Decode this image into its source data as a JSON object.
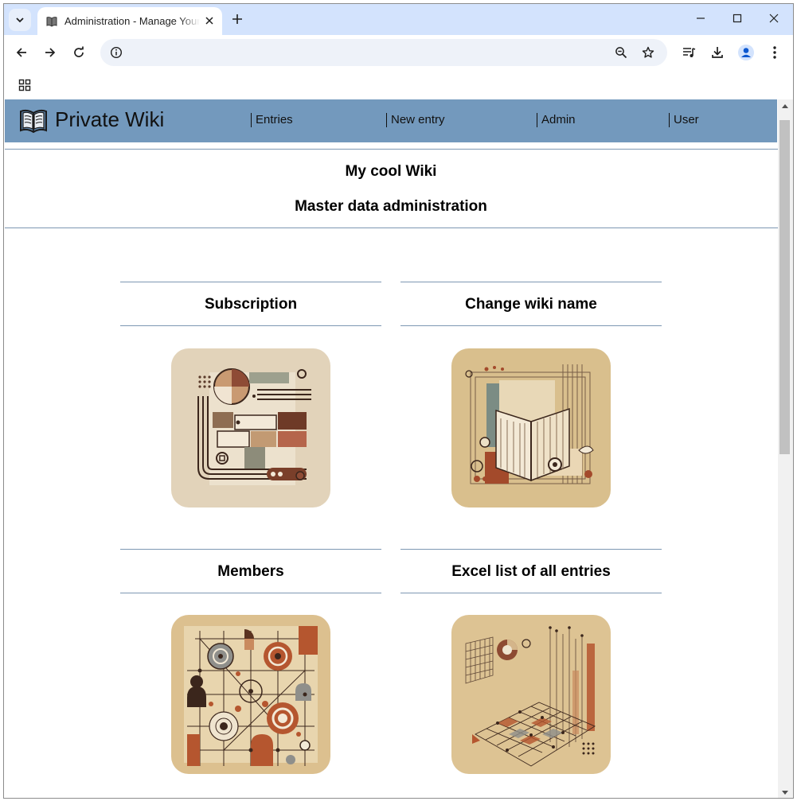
{
  "browser": {
    "tab_title": "Administration - Manage Your Private Wiki",
    "url": "",
    "colors": {
      "tabstrip": "#d3e3fd",
      "omnibox": "#eef2f9"
    }
  },
  "site": {
    "title": "Private Wiki",
    "nav": [
      {
        "label": "Entries"
      },
      {
        "label": "New entry"
      },
      {
        "label": "Admin"
      },
      {
        "label": "User"
      }
    ],
    "header_color": "#7399bd"
  },
  "page": {
    "wiki_name": "My cool Wiki",
    "section_title": "Master data administration"
  },
  "cards": [
    {
      "title": "Subscription"
    },
    {
      "title": "Change wiki name"
    },
    {
      "title": "Members"
    },
    {
      "title": "Excel list of all entries"
    }
  ]
}
